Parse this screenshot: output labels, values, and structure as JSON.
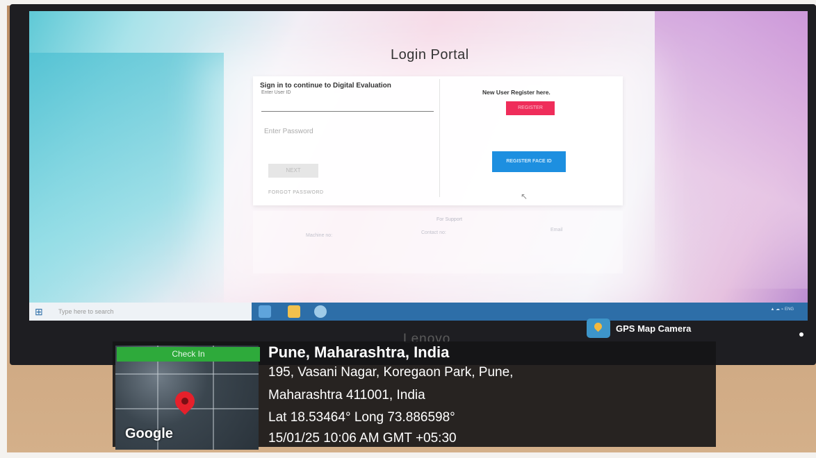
{
  "screen": {
    "portal_title": "Login Portal",
    "signin_title": "Sign in to continue to Digital Evaluation",
    "user_label": "Enter User ID",
    "password_placeholder": "Enter Password",
    "next_label": "NEXT",
    "forgot_label": "FORGOT PASSWORD",
    "new_user_label": "New User Register here.",
    "register_label": "REGISTER",
    "register_face_label": "REGISTER FACE ID"
  },
  "support": {
    "title": "For Support",
    "items": [
      "Machine no:",
      "Contact no:",
      "Email"
    ]
  },
  "taskbar": {
    "search_placeholder": "Type here to search"
  },
  "brand": "Lenovo",
  "gps_app_name": "GPS Map Camera",
  "overlay": {
    "checkin_label": "Check In",
    "city": "Pune, Maharashtra, India",
    "address_line1": "195, Vasani Nagar, Koregaon Park, Pune,",
    "address_line2": "Maharashtra 411001, India",
    "coords": "Lat 18.53464° Long 73.886598°",
    "datetime": "15/01/25 10:06 AM GMT +05:30",
    "map_brand": "Google"
  },
  "colors": {
    "register": "#ef2d5a",
    "face_register": "#1d8fe0",
    "checkin": "#2eaa3b",
    "pin": "#e6202b"
  }
}
